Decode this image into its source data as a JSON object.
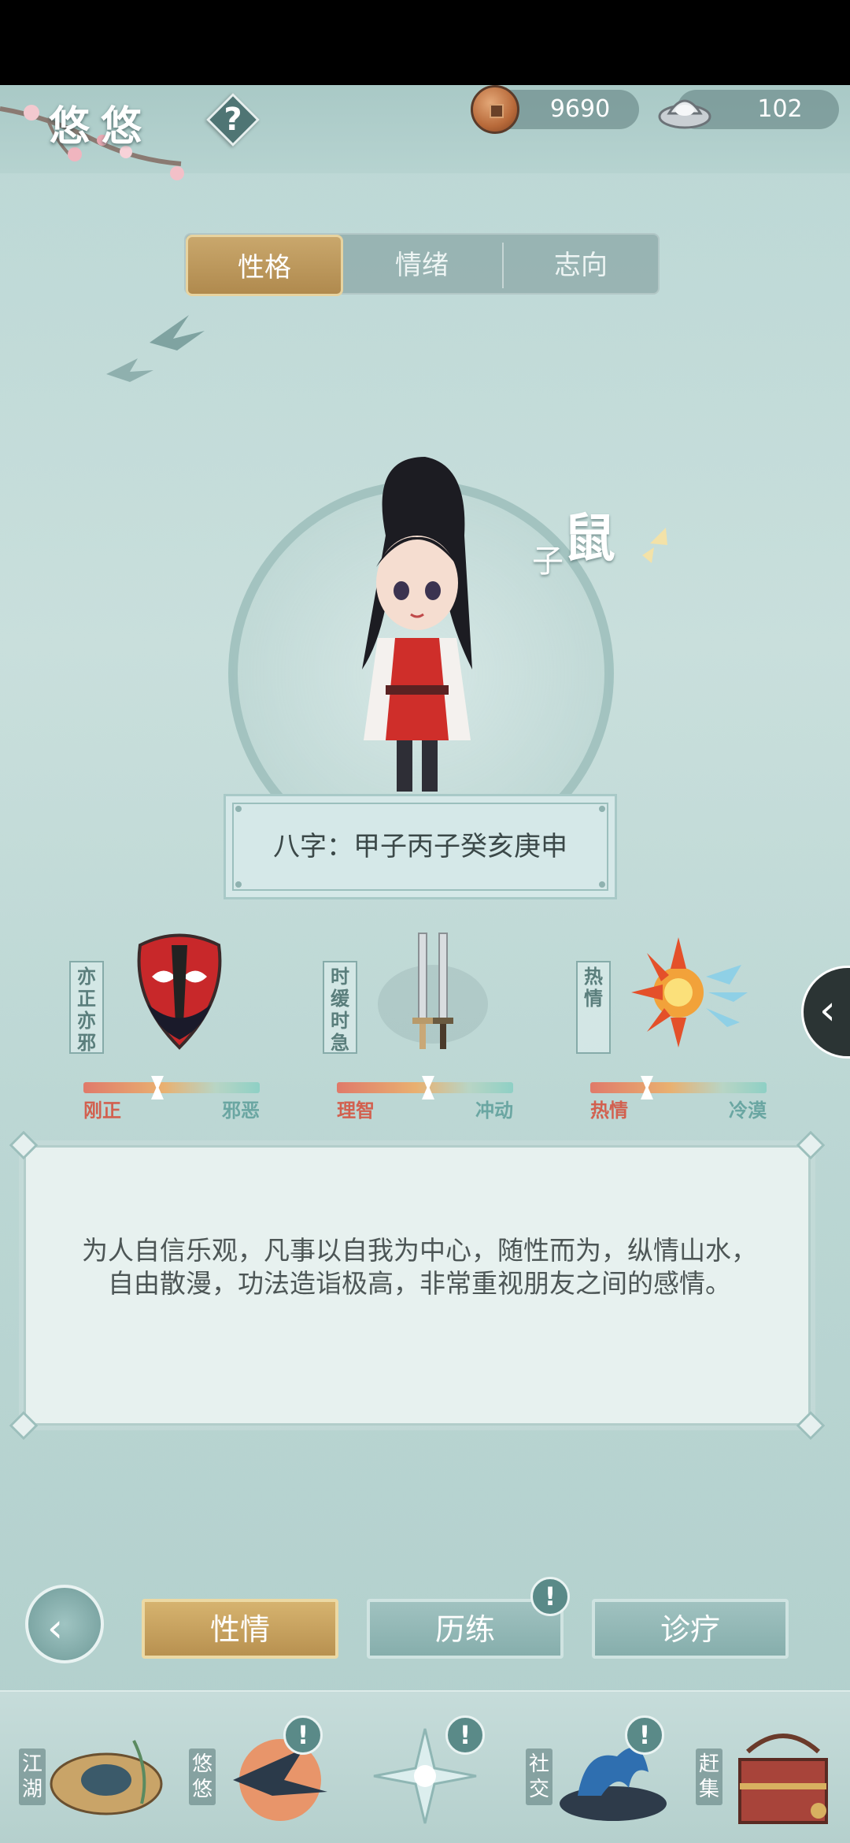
{
  "header": {
    "player_name": "悠悠",
    "help_symbol": "?",
    "copper_amount": "9690",
    "silver_amount": "102"
  },
  "tabs": [
    {
      "label": "性格",
      "active": true
    },
    {
      "label": "情绪",
      "active": false
    },
    {
      "label": "志向",
      "active": false
    }
  ],
  "character": {
    "zodiac_big": "鼠",
    "zodiac_small": "子",
    "bazi": "八字：甲子丙子癸亥庚申"
  },
  "traits": [
    {
      "label": "亦正亦邪",
      "low": "刚正",
      "high": "邪恶",
      "value": 0.42,
      "icon": "opera-mask-icon"
    },
    {
      "label": "时缓时急",
      "low": "理智",
      "high": "冲动",
      "value": 0.52,
      "icon": "twin-swords-icon"
    },
    {
      "label": "热情",
      "low": "热情",
      "high": "冷漠",
      "value": 0.33,
      "icon": "fire-ice-icon"
    }
  ],
  "description": "为人自信乐观，凡事以自我为中心，随性而为，纵情山水，自由散漫，功法造诣极高，非常重视朋友之间的感情。",
  "actions": {
    "back_symbol": "‹",
    "buttons": [
      {
        "label": "性情",
        "active": true
      },
      {
        "label": "历练",
        "active": false,
        "badge": "!"
      },
      {
        "label": "诊疗",
        "active": false
      }
    ]
  },
  "side_tab_symbol": "‹",
  "nav": [
    {
      "label": "江湖",
      "icon": "straw-hat-icon"
    },
    {
      "label": "悠悠",
      "icon": "swallow-sun-icon",
      "badge": "!"
    },
    {
      "label": "",
      "icon": "compass-star-icon",
      "badge": "!"
    },
    {
      "label": "社交",
      "icon": "wave-bowl-icon",
      "badge": "!"
    },
    {
      "label": "赶集",
      "icon": "market-box-icon"
    }
  ],
  "colors": {
    "accent_gold": "#c9a76c",
    "teal": "#86aeac",
    "background": "#c9dfdc"
  }
}
